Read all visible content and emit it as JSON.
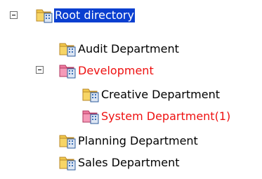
{
  "colors": {
    "text_default": "#000000",
    "text_highlight": "#ee1111",
    "selection_bg": "#0a3fd0",
    "selection_text": "#ffffff",
    "folder_yellow": "#f2c84b",
    "folder_pink": "#f07aa0",
    "doc_blue": "#3a6fb8"
  },
  "tree": {
    "root": {
      "label": "Root directory",
      "icon": "folder-building-icon",
      "expanded": true,
      "selected": true
    },
    "nodes": [
      {
        "label": "Audit Department",
        "icon": "folder-building-icon",
        "color": "default"
      },
      {
        "label": "Development",
        "icon": "folder-building-pink-icon",
        "color": "highlight",
        "expanded": true
      },
      {
        "label": "Creative Department",
        "icon": "folder-building-icon",
        "color": "default"
      },
      {
        "label": "System Department(1)",
        "icon": "folder-building-pink-icon",
        "color": "highlight"
      },
      {
        "label": "Planning Department",
        "icon": "folder-building-icon",
        "color": "default"
      },
      {
        "label": "Sales Department",
        "icon": "folder-building-icon",
        "color": "default"
      }
    ]
  }
}
